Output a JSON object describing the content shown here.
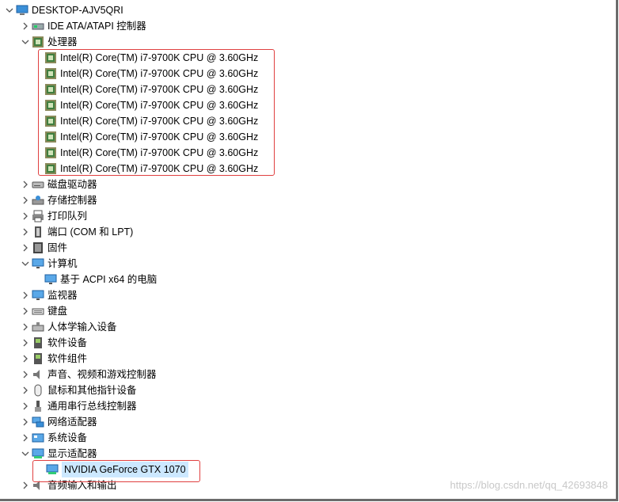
{
  "root": {
    "label": "DESKTOP-AJV5QRI"
  },
  "ide": {
    "label": "IDE ATA/ATAPI 控制器"
  },
  "processors": {
    "label": "处理器",
    "items": [
      "Intel(R) Core(TM) i7-9700K CPU @ 3.60GHz",
      "Intel(R) Core(TM) i7-9700K CPU @ 3.60GHz",
      "Intel(R) Core(TM) i7-9700K CPU @ 3.60GHz",
      "Intel(R) Core(TM) i7-9700K CPU @ 3.60GHz",
      "Intel(R) Core(TM) i7-9700K CPU @ 3.60GHz",
      "Intel(R) Core(TM) i7-9700K CPU @ 3.60GHz",
      "Intel(R) Core(TM) i7-9700K CPU @ 3.60GHz",
      "Intel(R) Core(TM) i7-9700K CPU @ 3.60GHz"
    ]
  },
  "disk": {
    "label": "磁盘驱动器"
  },
  "storage": {
    "label": "存储控制器"
  },
  "printq": {
    "label": "打印队列"
  },
  "ports": {
    "label": "端口 (COM 和 LPT)"
  },
  "firmware": {
    "label": "固件"
  },
  "computer": {
    "label": "计算机",
    "child": "基于 ACPI x64 的电脑"
  },
  "monitors": {
    "label": "监视器"
  },
  "keyboard": {
    "label": "键盘"
  },
  "hid": {
    "label": "人体学输入设备"
  },
  "swdevice": {
    "label": "软件设备"
  },
  "swcomponent": {
    "label": "软件组件"
  },
  "sound": {
    "label": "声音、视频和游戏控制器"
  },
  "mice": {
    "label": "鼠标和其他指针设备"
  },
  "usb": {
    "label": "通用串行总线控制器"
  },
  "network": {
    "label": "网络适配器"
  },
  "system": {
    "label": "系统设备"
  },
  "display": {
    "label": "显示适配器",
    "child": "NVIDIA GeForce GTX 1070"
  },
  "audio": {
    "label": "音频输入和输出"
  },
  "watermark": "https://blog.csdn.net/qq_42693848",
  "colors": {
    "highlight_box": "#e04040",
    "selection": "#cce8ff"
  }
}
